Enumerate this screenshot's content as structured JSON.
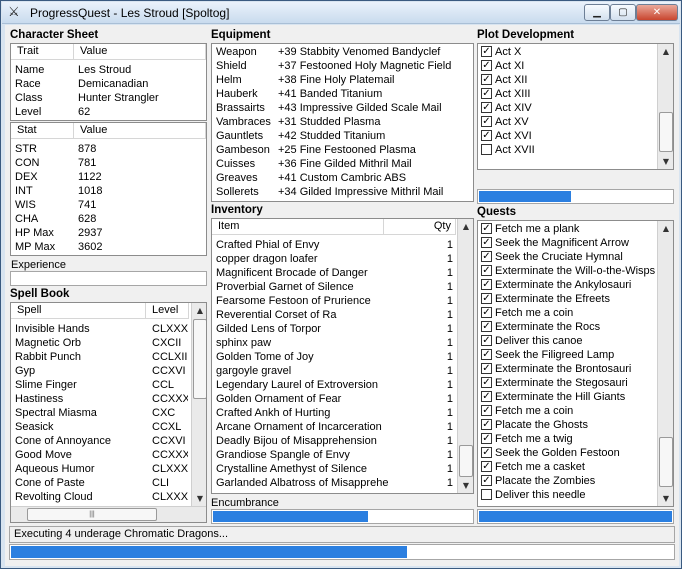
{
  "window": {
    "title": "ProgressQuest - Les Stroud [Spoltog]",
    "icon": "crossed-swords-icon"
  },
  "character": {
    "heading": "Character Sheet",
    "traits_header": [
      "Trait",
      "Value"
    ],
    "traits": [
      [
        "Name",
        "Les Stroud"
      ],
      [
        "Race",
        "Demicanadian"
      ],
      [
        "Class",
        "Hunter Strangler"
      ],
      [
        "Level",
        "62"
      ]
    ],
    "stats_header": [
      "Stat",
      "Value"
    ],
    "stats": [
      [
        "STR",
        "878"
      ],
      [
        "CON",
        "781"
      ],
      [
        "DEX",
        "1122"
      ],
      [
        "INT",
        "1018"
      ],
      [
        "WIS",
        "741"
      ],
      [
        "CHA",
        "628"
      ],
      [
        "HP Max",
        "2937"
      ],
      [
        "MP Max",
        "3602"
      ]
    ],
    "experience_label": "Experience",
    "experience_progress": 0.01
  },
  "spellbook": {
    "heading": "Spell Book",
    "header": [
      "Spell",
      "Level"
    ],
    "spells": [
      [
        "Invisible Hands",
        "CLXXXV"
      ],
      [
        "Magnetic Orb",
        "CXCII"
      ],
      [
        "Rabbit Punch",
        "CCLXIII"
      ],
      [
        "Gyp",
        "CCXVI"
      ],
      [
        "Slime Finger",
        "CCL"
      ],
      [
        "Hastiness",
        "CCXXX"
      ],
      [
        "Spectral Miasma",
        "CXC"
      ],
      [
        "Seasick",
        "CCXL"
      ],
      [
        "Cone of Annoyance",
        "CCXVI"
      ],
      [
        "Good Move",
        "CCXXX"
      ],
      [
        "Aqueous Humor",
        "CLXXX"
      ],
      [
        "Cone of Paste",
        "CLI"
      ],
      [
        "Revolting Cloud",
        "CLXXXI"
      ]
    ]
  },
  "equipment": {
    "heading": "Equipment",
    "items": [
      [
        "Weapon",
        "+39 Stabbity Venomed Bandyclef"
      ],
      [
        "Shield",
        "+37 Festooned Holy Magnetic Field"
      ],
      [
        "Helm",
        "+38 Fine Holy Platemail"
      ],
      [
        "Hauberk",
        "+41 Banded Titanium"
      ],
      [
        "Brassairts",
        "+43 Impressive Gilded Scale Mail"
      ],
      [
        "Vambraces",
        "+31 Studded Plasma"
      ],
      [
        "Gauntlets",
        "+42 Studded Titanium"
      ],
      [
        "Gambeson",
        "+25 Fine Festooned Plasma"
      ],
      [
        "Cuisses",
        "+36 Fine Gilded Mithril Mail"
      ],
      [
        "Greaves",
        "+41 Custom Cambric ABS"
      ],
      [
        "Sollerets",
        "+34 Gilded Impressive Mithril Mail"
      ]
    ]
  },
  "inventory": {
    "heading": "Inventory",
    "header": [
      "Item",
      "Qty"
    ],
    "items": [
      [
        "Crafted Phial of Envy",
        "1"
      ],
      [
        "copper dragon loafer",
        "1"
      ],
      [
        "Magnificent Brocade of Danger",
        "1"
      ],
      [
        "Proverbial Garnet of Silence",
        "1"
      ],
      [
        "Fearsome Festoon of Prurience",
        "1"
      ],
      [
        "Reverential Corset of Ra",
        "1"
      ],
      [
        "Gilded Lens of Torpor",
        "1"
      ],
      [
        "sphinx paw",
        "1"
      ],
      [
        "Golden Tome of Joy",
        "1"
      ],
      [
        "gargoyle gravel",
        "1"
      ],
      [
        "Legendary Laurel of Extroversion",
        "1"
      ],
      [
        "Golden Ornament of Fear",
        "1"
      ],
      [
        "Crafted Ankh of Hurting",
        "1"
      ],
      [
        "Arcane Ornament of Incarceration",
        "1"
      ],
      [
        "Deadly Bijou of Misapprehension",
        "1"
      ],
      [
        "Grandiose Spangle of Envy",
        "1"
      ],
      [
        "Crystalline Amethyst of Silence",
        "1"
      ],
      [
        "Garlanded Albatross of Misapprehension",
        "1"
      ]
    ],
    "encumbrance_label": "Encumbrance",
    "encumbrance_progress": 0.6
  },
  "plot": {
    "heading": "Plot Development",
    "acts": [
      [
        "Act X",
        true
      ],
      [
        "Act XI",
        true
      ],
      [
        "Act XII",
        true
      ],
      [
        "Act XIII",
        true
      ],
      [
        "Act XIV",
        true
      ],
      [
        "Act XV",
        true
      ],
      [
        "Act XVI",
        true
      ],
      [
        "Act XVII",
        false
      ]
    ],
    "progress": 0.48
  },
  "quests": {
    "heading": "Quests",
    "items": [
      [
        "Fetch me a plank",
        true
      ],
      [
        "Seek the Magnificent Arrow",
        true
      ],
      [
        "Seek the Cruciate Hymnal",
        true
      ],
      [
        "Exterminate the Will-o-the-Wisps",
        true
      ],
      [
        "Exterminate the Ankylosauri",
        true
      ],
      [
        "Exterminate the Efreets",
        true
      ],
      [
        "Fetch me a coin",
        true
      ],
      [
        "Exterminate the Rocs",
        true
      ],
      [
        "Deliver this canoe",
        true
      ],
      [
        "Seek the Filigreed Lamp",
        true
      ],
      [
        "Exterminate the Brontosauri",
        true
      ],
      [
        "Exterminate the Stegosauri",
        true
      ],
      [
        "Exterminate the Hill Giants",
        true
      ],
      [
        "Fetch me a coin",
        true
      ],
      [
        "Placate the Ghosts",
        true
      ],
      [
        "Fetch me a twig",
        true
      ],
      [
        "Seek the Golden Festoon",
        true
      ],
      [
        "Fetch me a casket",
        true
      ],
      [
        "Placate the Zombies",
        true
      ],
      [
        "Deliver this needle",
        false
      ]
    ],
    "progress": 1.0
  },
  "status": {
    "text": "Executing 4 underage Chromatic Dragons...",
    "progress": 0.6
  },
  "colors": {
    "progress_fill": "#2b7fe0",
    "window_frame": "#d8e4f0"
  }
}
